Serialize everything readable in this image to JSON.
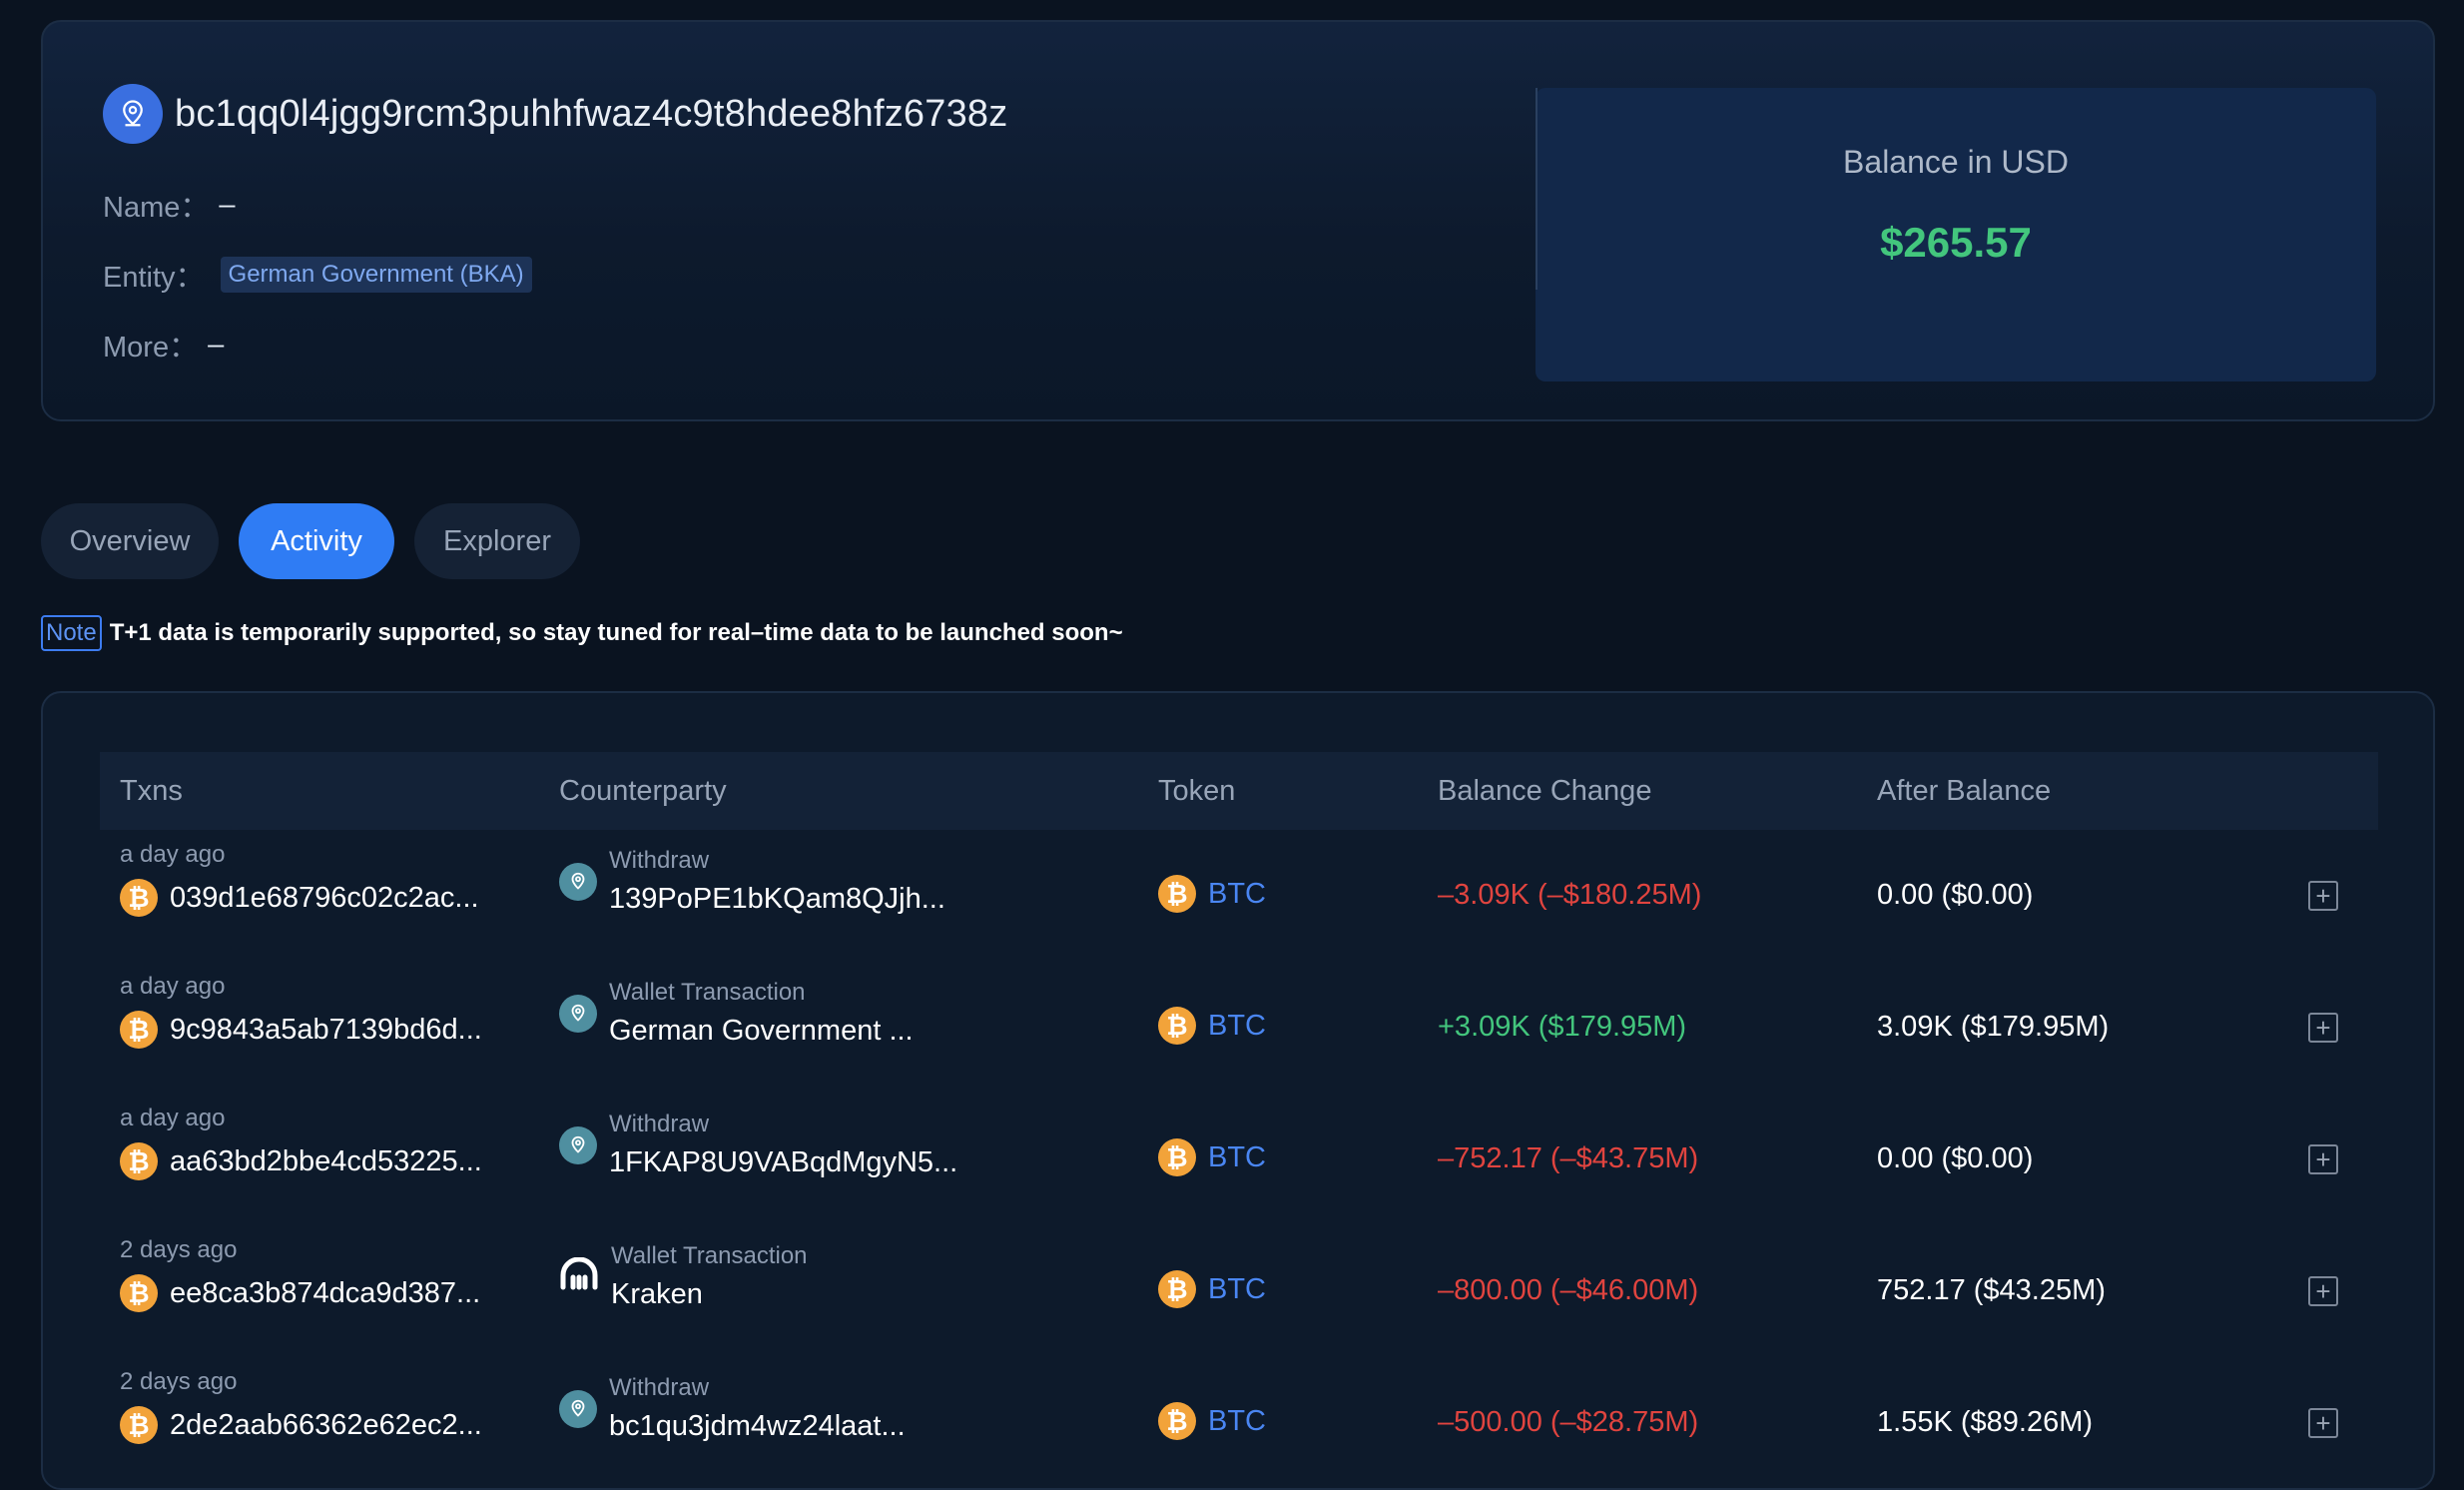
{
  "address": {
    "text": "bc1qq0l4jgg9rcm3puhhfwaz4c9t8hdee8hfz6738z",
    "icon": "location-pin-icon"
  },
  "meta": {
    "name_label": "Name：",
    "name_value": "–",
    "entity_label": "Entity：",
    "entity_value": "German Government (BKA)",
    "more_label": "More：",
    "more_value": "–"
  },
  "balance": {
    "label": "Balance in USD",
    "value": "$265.57"
  },
  "tabs": [
    {
      "label": "Overview",
      "active": false
    },
    {
      "label": "Activity",
      "active": true
    },
    {
      "label": "Explorer",
      "active": false
    }
  ],
  "note": {
    "tag": "Note",
    "text": "T+1 data is temporarily supported, so stay tuned for real–time data to be launched soon~"
  },
  "table": {
    "headers": {
      "txns": "Txns",
      "counterparty": "Counterparty",
      "token": "Token",
      "balance_change": "Balance Change",
      "after_balance": "After Balance"
    },
    "rows": [
      {
        "time": "a day ago",
        "hash": "039d1e68796c02c2ac...",
        "cp_type": "Withdraw",
        "cp_name": "139PoPE1bKQam8QJjh...",
        "cp_icon": "location-pin-icon",
        "token": "BTC",
        "change": "–3.09K (–$180.25M)",
        "change_sign": "neg",
        "after": "0.00 ($0.00)"
      },
      {
        "time": "a day ago",
        "hash": "9c9843a5ab7139bd6d...",
        "cp_type": "Wallet Transaction",
        "cp_name": "German Government ...",
        "cp_icon": "location-pin-icon",
        "token": "BTC",
        "change": "+3.09K ($179.95M)",
        "change_sign": "pos",
        "after": "3.09K ($179.95M)"
      },
      {
        "time": "a day ago",
        "hash": "aa63bd2bbe4cd53225...",
        "cp_type": "Withdraw",
        "cp_name": "1FKAP8U9VABqdMgyN5...",
        "cp_icon": "location-pin-icon",
        "token": "BTC",
        "change": "–752.17 (–$43.75M)",
        "change_sign": "neg",
        "after": "0.00 ($0.00)"
      },
      {
        "time": "2 days ago",
        "hash": "ee8ca3b874dca9d387...",
        "cp_type": "Wallet Transaction",
        "cp_name": "Kraken",
        "cp_icon": "kraken-logo-icon",
        "token": "BTC",
        "change": "–800.00 (–$46.00M)",
        "change_sign": "neg",
        "after": "752.17 ($43.25M)"
      },
      {
        "time": "2 days ago",
        "hash": "2de2aab66362e62ec2...",
        "cp_type": "Withdraw",
        "cp_name": "bc1qu3jdm4wz24laat...",
        "cp_icon": "location-pin-icon",
        "token": "BTC",
        "change": "–500.00 (–$28.75M)",
        "change_sign": "neg",
        "after": "1.55K ($89.26M)"
      }
    ]
  },
  "colors": {
    "accent": "#2f7cf4",
    "positive": "#43c67d",
    "negative": "#e0443f",
    "btc": "#f2a33a"
  }
}
